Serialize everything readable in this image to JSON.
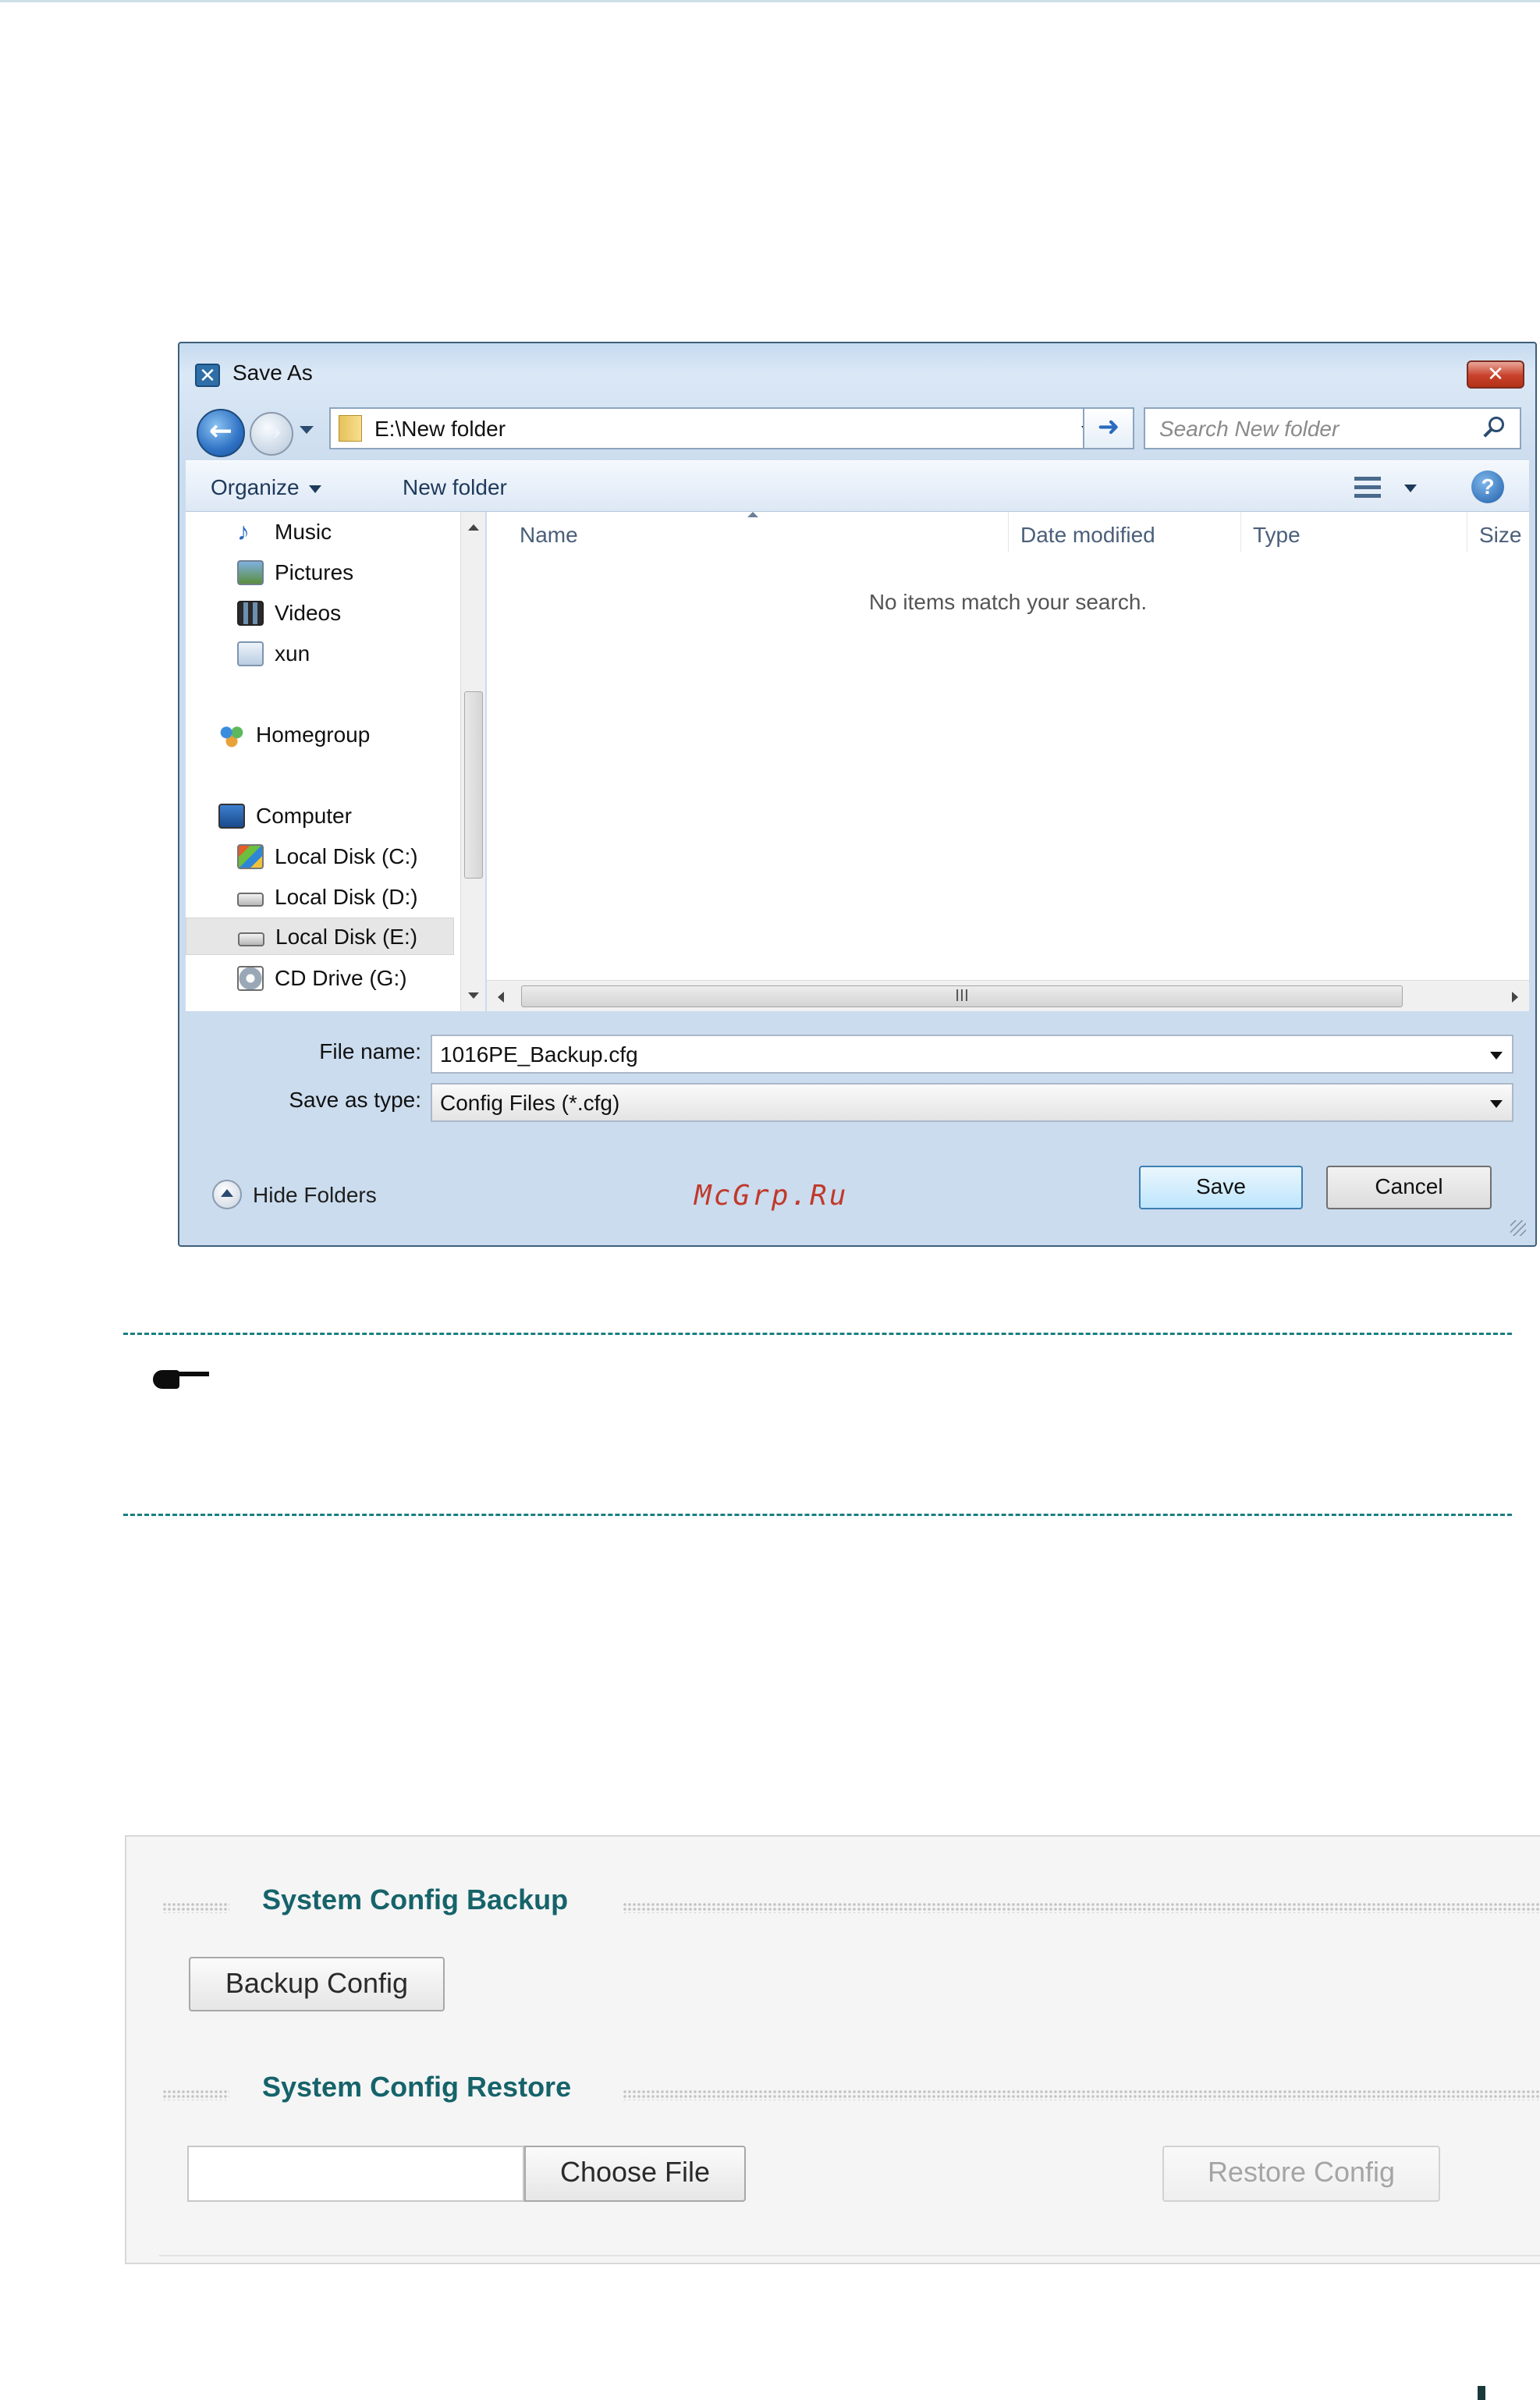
{
  "dialog": {
    "title": "Save As",
    "close_glyph": "✕",
    "address_path": "E:\\New folder",
    "search_placeholder": "Search New folder",
    "toolbar": {
      "organize": "Organize",
      "new_folder": "New folder",
      "help_glyph": "?"
    },
    "nav_items": [
      {
        "label": "Music",
        "icon": "music-icon"
      },
      {
        "label": "Pictures",
        "icon": "pictures-icon"
      },
      {
        "label": "Videos",
        "icon": "videos-icon"
      },
      {
        "label": "xun",
        "icon": "user-folder-icon"
      },
      {
        "label": "Homegroup",
        "icon": "homegroup-icon"
      },
      {
        "label": "Computer",
        "icon": "computer-icon"
      },
      {
        "label": "Local Disk (C:)",
        "icon": "system-disk-icon"
      },
      {
        "label": "Local Disk (D:)",
        "icon": "disk-icon"
      },
      {
        "label": "Local Disk (E:)",
        "icon": "disk-icon",
        "selected": true
      },
      {
        "label": "CD Drive (G:)",
        "icon": "cd-drive-icon"
      }
    ],
    "columns": [
      "Name",
      "Date modified",
      "Type",
      "Size"
    ],
    "empty_message": "No items match your search.",
    "hscroll_grip": "III",
    "file_name_label": "File name:",
    "file_name_value": "1016PE_Backup.cfg",
    "save_type_label": "Save as type:",
    "save_type_value": "Config Files (*.cfg)",
    "hide_folders": "Hide Folders",
    "save_button": "Save",
    "cancel_button": "Cancel"
  },
  "watermark": "McGrp.Ru",
  "config_panel": {
    "backup_title": "System Config Backup",
    "backup_button": "Backup Config",
    "restore_title": "System Config Restore",
    "choose_file_button": "Choose File",
    "restore_button": "Restore Config"
  },
  "colors": {
    "accent_teal": "#16636a",
    "dialog_frame": "#3e5f7a",
    "close_red": "#c9412a",
    "watermark_red": "#c0392b"
  }
}
